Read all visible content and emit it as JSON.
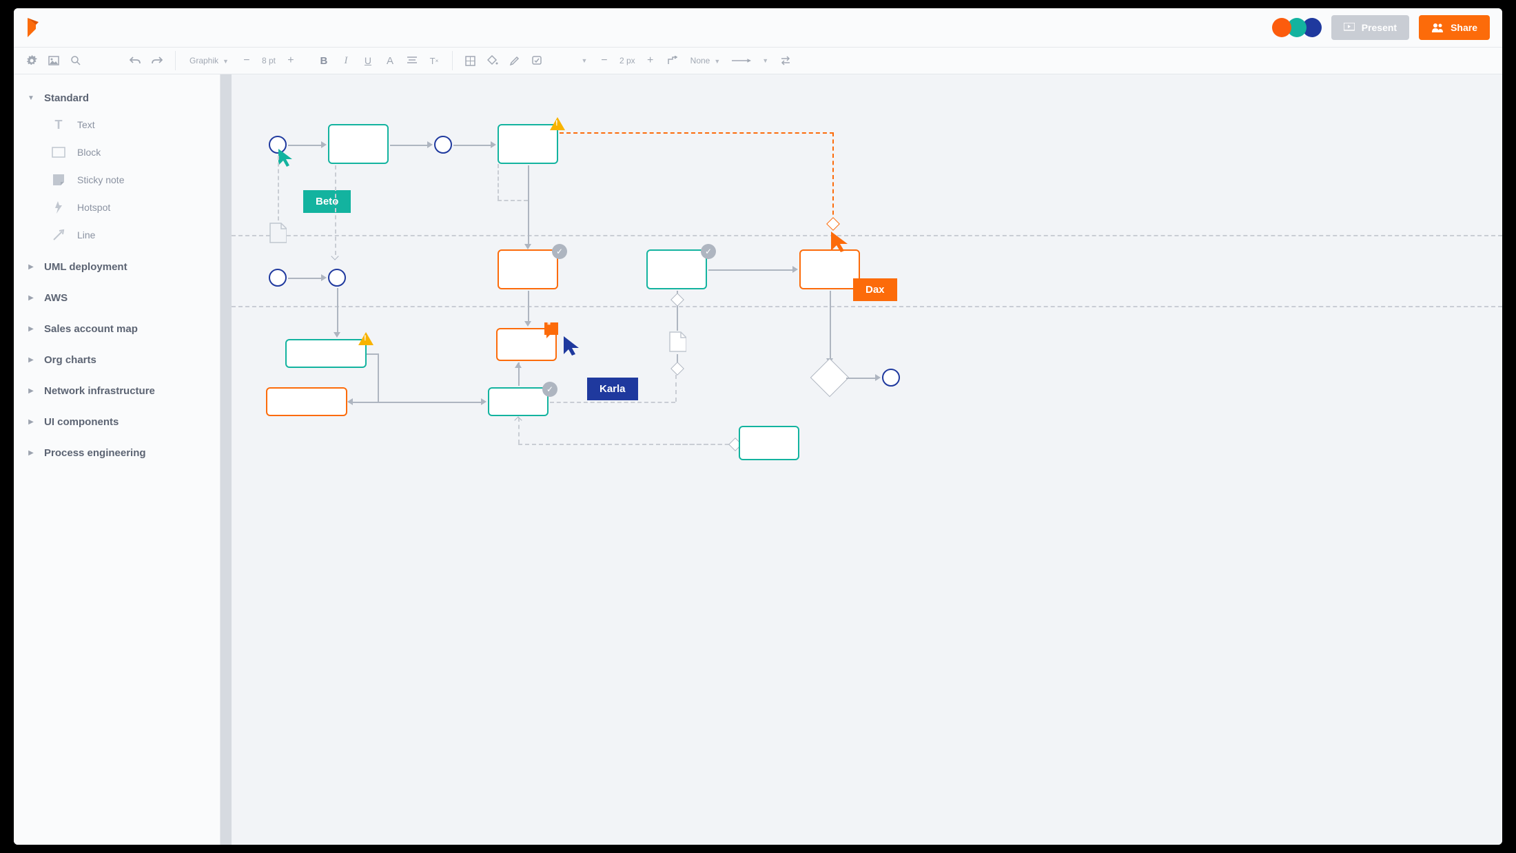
{
  "header": {
    "present_label": "Present",
    "share_label": "Share",
    "avatar_colors": [
      "#fc5c0d",
      "#13b39f",
      "#1f399e"
    ]
  },
  "toolbar": {
    "font_family": "Graphik",
    "font_size": "8 pt",
    "border_width": "2 px",
    "border_style": "None"
  },
  "sidebar": {
    "sections": [
      {
        "title": "Standard",
        "expanded": true,
        "items": [
          {
            "label": "Text",
            "icon": "text-icon"
          },
          {
            "label": "Block",
            "icon": "block-icon"
          },
          {
            "label": "Sticky note",
            "icon": "sticky-icon"
          },
          {
            "label": "Hotspot",
            "icon": "hotspot-icon"
          },
          {
            "label": "Line",
            "icon": "line-icon"
          }
        ]
      },
      {
        "title": "UML deployment",
        "expanded": false
      },
      {
        "title": "AWS",
        "expanded": false
      },
      {
        "title": "Sales account map",
        "expanded": false
      },
      {
        "title": "Org charts",
        "expanded": false
      },
      {
        "title": "Network infrastructure",
        "expanded": false
      },
      {
        "title": "UI components",
        "expanded": false
      },
      {
        "title": "Process engineering",
        "expanded": false
      }
    ]
  },
  "cursors": {
    "beto": "Beto",
    "karla": "Karla",
    "dax": "Dax"
  },
  "colors": {
    "orange": "#fc6b0a",
    "teal": "#13b39f",
    "navy": "#1f399e",
    "grey": "#aeb5c0"
  }
}
